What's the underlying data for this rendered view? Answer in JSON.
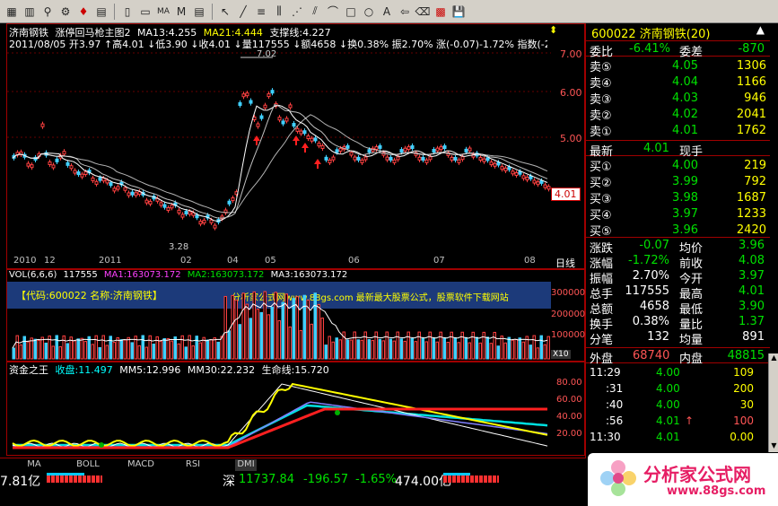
{
  "toolbar": {
    "icons": [
      "grid-icon",
      "chart-icon",
      "zoom-icon",
      "gear-icon",
      "alarm-icon",
      "compare-icon",
      "layout-icon",
      "window-icon",
      "ma-icon",
      "m-icon",
      "table-icon",
      "cursor-icon",
      "line-icon",
      "hline-icon",
      "channel-icon",
      "fan-icon",
      "parallel-icon",
      "arc-icon",
      "rect-icon",
      "circle-icon",
      "text-icon",
      "arrow-icon",
      "eraser-icon",
      "color-icon",
      "save-icon"
    ],
    "ma_label": "MA",
    "m_label": "M",
    "text_label": "A"
  },
  "chart": {
    "stock_name": "济南钢铁",
    "formula_name": "涨停回马枪主图2",
    "ma13": "MA13:4.255",
    "ma21": "MA21:4.444",
    "support": "支撑线:4.227",
    "ohlc_line": "2011/08/05 开3.97 ↑高4.01 ↓低3.90 ↓收4.01 ↓量117555 ↓额4658 ↓换0.38% 振2.70% 涨(-0.07)-1.72% 指数(-2",
    "high_label": "7.02",
    "low_label": "3.28",
    "price_axis": [
      "7.00",
      "6.00",
      "5.00"
    ],
    "current_price": "4.01",
    "date_axis": [
      "2010",
      "12",
      "2011",
      "02",
      "04",
      "05",
      "06",
      "07",
      "08"
    ],
    "line_mode": "日线",
    "vol_header": "VOL(6,6,6)",
    "vol_val": "117555",
    "vol_ma1": "MA1:163073.172",
    "vol_ma2": "MA2:163073.172",
    "vol_ma3": "MA3:163073.172",
    "vol_axis": [
      "300000",
      "200000",
      "100000"
    ],
    "vol_unit": "X10",
    "code_info": "【代码:600022 名称:济南钢铁】",
    "watermark": "分析家公式网www.88gs.com 最新最大股票公式，股票软件下载网站",
    "ind_header": "资金之王",
    "ind_close": "收盘:11.497",
    "ind_mm5": "MM5:12.996",
    "ind_mm30": "MM30:22.232",
    "ind_life": "生命线:15.720",
    "ind_axis": [
      "80.00",
      "60.00",
      "40.00",
      "20.00"
    ]
  },
  "panel": {
    "code_title": "600022 济南钢铁(20)",
    "weibi_label": "委比",
    "weibi_val": "-6.41%",
    "weicha_label": "委差",
    "weicha_val": "-870",
    "sells": [
      {
        "label": "卖⑤",
        "price": "4.05",
        "vol": "1306"
      },
      {
        "label": "卖④",
        "price": "4.04",
        "vol": "1166"
      },
      {
        "label": "卖③",
        "price": "4.03",
        "vol": "946"
      },
      {
        "label": "卖②",
        "price": "4.02",
        "vol": "2041"
      },
      {
        "label": "卖①",
        "price": "4.01",
        "vol": "1762"
      }
    ],
    "latest_label": "最新",
    "latest_val": "4.01",
    "xianshou_label": "现手",
    "buys": [
      {
        "label": "买①",
        "price": "4.00",
        "vol": "219"
      },
      {
        "label": "买②",
        "price": "3.99",
        "vol": "792"
      },
      {
        "label": "买③",
        "price": "3.98",
        "vol": "1687"
      },
      {
        "label": "买④",
        "price": "3.97",
        "vol": "1233"
      },
      {
        "label": "买⑤",
        "price": "3.96",
        "vol": "2420"
      }
    ],
    "stats": [
      {
        "l1": "涨跌",
        "v1": "-0.07",
        "l2": "均价",
        "v2": "3.96"
      },
      {
        "l1": "涨幅",
        "v1": "-1.72%",
        "l2": "前收",
        "v2": "4.08"
      },
      {
        "l1": "振幅",
        "v1": "2.70%",
        "l2": "今开",
        "v2": "3.97"
      },
      {
        "l1": "总手",
        "v1": "117555",
        "l2": "最高",
        "v2": "4.01"
      },
      {
        "l1": "总额",
        "v1": "4658",
        "l2": "最低",
        "v2": "3.90"
      },
      {
        "l1": "换手",
        "v1": "0.38%",
        "l2": "量比",
        "v2": "1.37"
      },
      {
        "l1": "分笔",
        "v1": "132",
        "l2": "均量",
        "v2": "891"
      }
    ],
    "outer_label": "外盘",
    "outer_val": "68740",
    "inner_label": "内盘",
    "inner_val": "48815",
    "ticks": [
      {
        "time": "11:29",
        "price": "4.00",
        "vol": "109"
      },
      {
        "time": ":31",
        "price": "4.00",
        "vol": "200"
      },
      {
        "time": ":40",
        "price": "4.00",
        "vol": "30"
      },
      {
        "time": ":56",
        "price": "4.01",
        "vol": "100"
      },
      {
        "time": "11:30",
        "price": "4.01",
        "vol": "0.00"
      }
    ]
  },
  "bottom": {
    "tabs": [
      "MA",
      "BOLL",
      "MACD",
      "RSI",
      "DMI"
    ],
    "left_amount": "7.81亿",
    "sz_label": "深",
    "sz_index": "11737.84",
    "sz_change": "-196.57",
    "sz_pct": "-1.65%",
    "sz_amount": "474.00亿",
    "logo_text": "分析家公式网",
    "logo_url": "www.88gs.com"
  }
}
